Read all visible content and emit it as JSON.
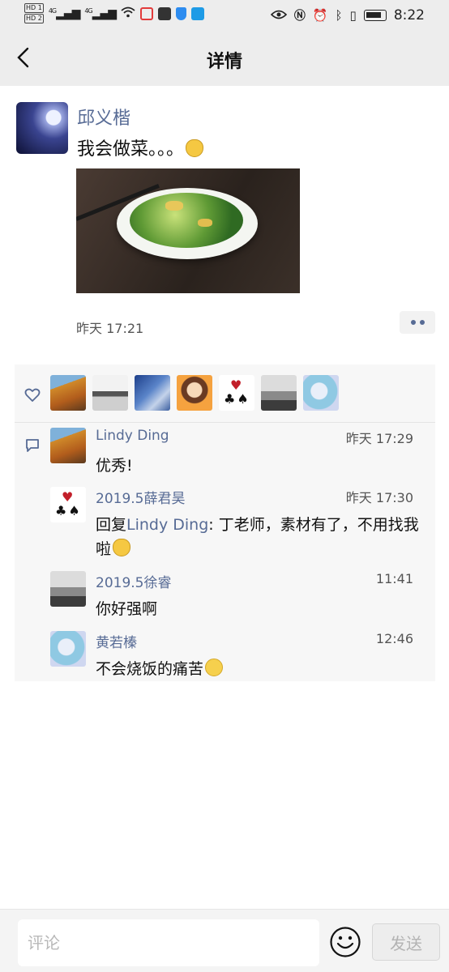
{
  "status_bar": {
    "time": "8:22",
    "hd_labels": [
      "HD 1",
      "HD 2"
    ],
    "network": [
      "4G",
      "4G"
    ],
    "icons": [
      "signal-icon",
      "wifi-icon",
      "app-icon",
      "app-icon",
      "shield-icon",
      "search-icon",
      "eye-icon",
      "nfc-icon",
      "alarm-icon",
      "bluetooth-icon",
      "vibrate-icon",
      "battery-icon"
    ]
  },
  "nav": {
    "title": "详情",
    "back_icon": "chevron-left-icon"
  },
  "post": {
    "author": "邱义楷",
    "text": "我会做菜。。。",
    "time": "昨天 17:21"
  },
  "likes": {
    "avatars": [
      "autumn-tree",
      "bridge",
      "building",
      "cartoon-girl",
      "playing-cards",
      "bare-tree",
      "anime-girl"
    ]
  },
  "comments": [
    {
      "name": "Lindy Ding",
      "time": "昨天 17:29",
      "text": "优秀!",
      "avatar": "autumn-tree"
    },
    {
      "name": "2019.5薛君昊",
      "time": "昨天 17:30",
      "reply_prefix": "回复",
      "reply_to": "Lindy Ding",
      "text": ": 丁老师，素材有了，不用找我啦",
      "avatar": "playing-cards"
    },
    {
      "name": "2019.5徐睿",
      "time": "11:41",
      "text": "你好强啊",
      "avatar": "bare-tree"
    },
    {
      "name": "黄若榛",
      "time": "12:46",
      "text": "不会烧饭的痛苦",
      "avatar": "anime-girl"
    }
  ],
  "bottom": {
    "placeholder": "评论",
    "send_label": "发送"
  },
  "colors": {
    "link": "#576b95",
    "header_bg": "#ededed",
    "panel_bg": "#f7f7f7"
  }
}
